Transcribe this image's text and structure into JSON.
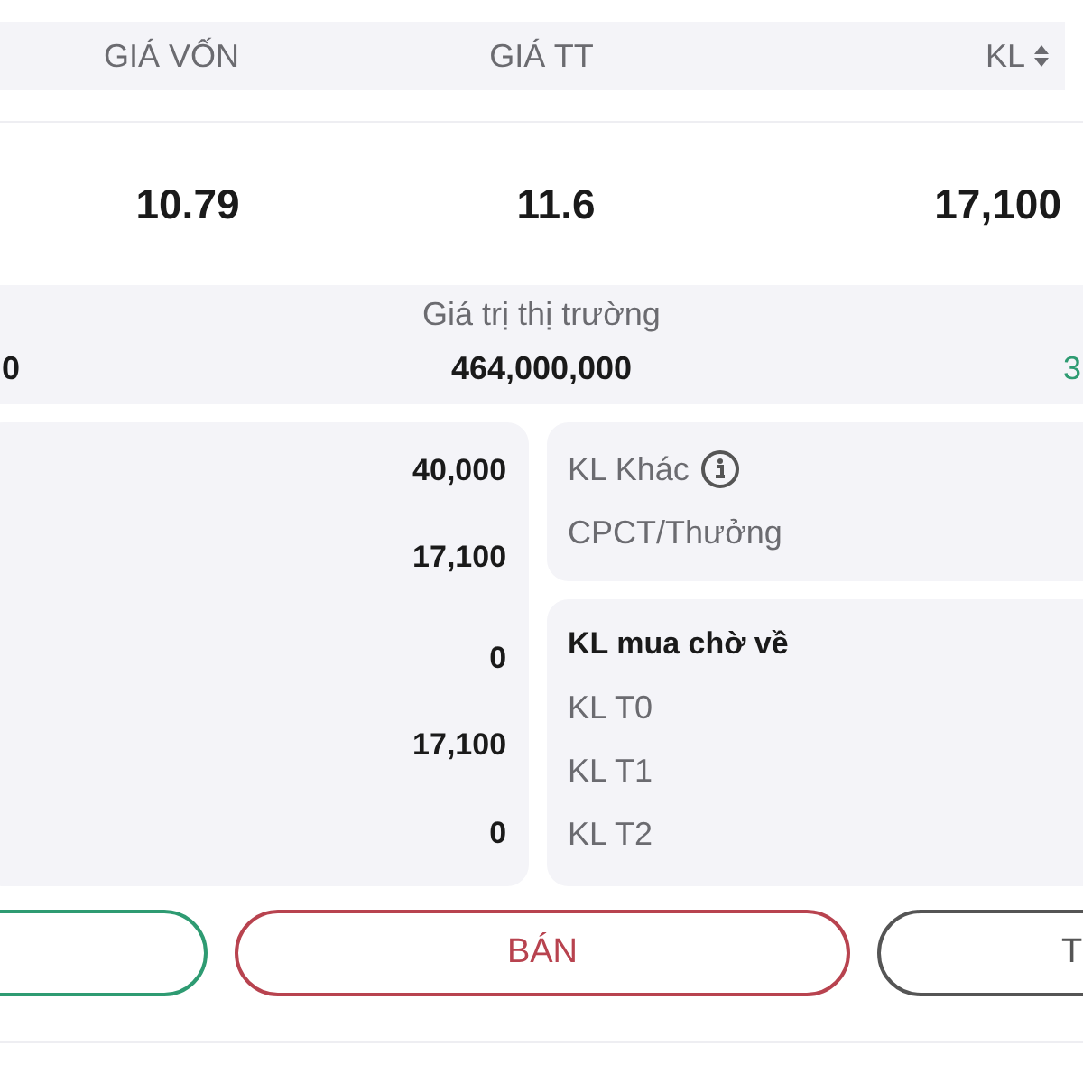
{
  "table_header": {
    "columns": [
      {
        "label": "GIÁ VỐN"
      },
      {
        "label": "GIÁ TT"
      },
      {
        "label": "KL",
        "sortable": true
      }
    ]
  },
  "row": {
    "cells": [
      "10.79",
      "11.6",
      "17,100"
    ]
  },
  "market_value": {
    "left_value": "0",
    "label": "Giá trị thị trường",
    "value": "464,000,000",
    "right_value": "3"
  },
  "volumes": [
    "40,000",
    "17,100",
    "0",
    "17,100",
    "0"
  ],
  "other_volume": {
    "label": "KL Khác",
    "info": true,
    "bonus_label": "CPCT/Thưởng"
  },
  "pending_buy": {
    "title": "KL mua chờ về",
    "items": [
      "KL T0",
      "KL T1",
      "KL T2"
    ]
  },
  "buttons": [
    {
      "color": "#2e9b72"
    },
    {
      "label": "BÁN",
      "color": "#b8434f"
    },
    {
      "label": "T",
      "color": "#555555"
    }
  ]
}
